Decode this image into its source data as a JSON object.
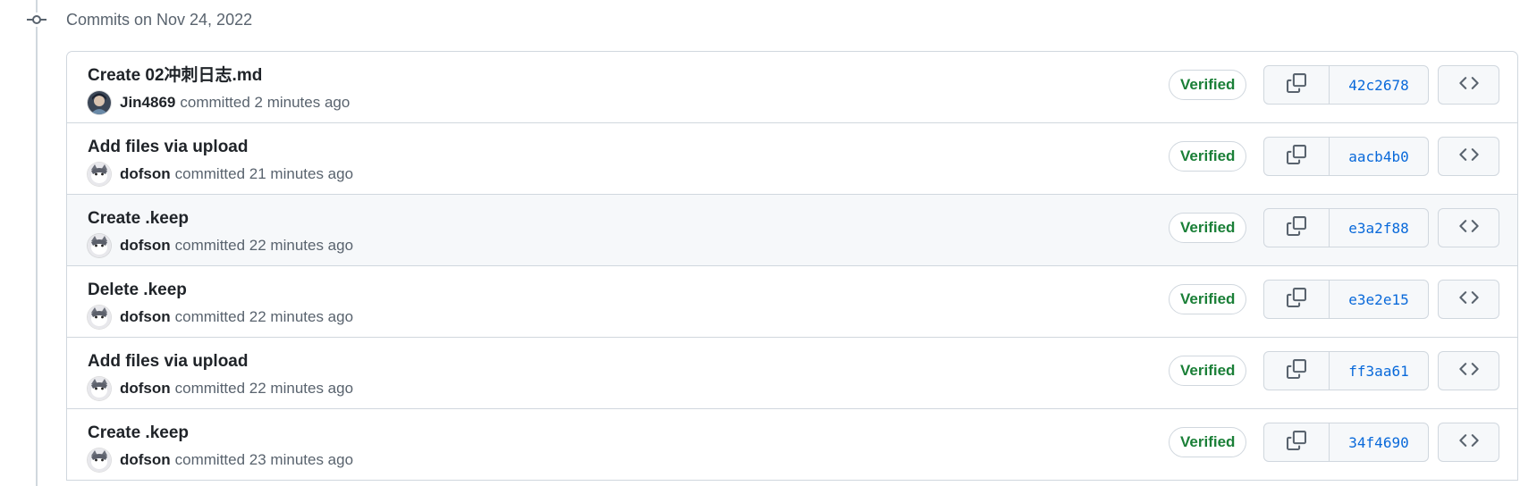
{
  "group": {
    "title": "Commits on Nov 24, 2022"
  },
  "commits": [
    {
      "title": "Create 02冲刺日志.md",
      "author": "Jin4869",
      "time_text": "committed 2 minutes ago",
      "badge": "Verified",
      "sha": "42c2678",
      "avatar_icon": "avatar-jin4869"
    },
    {
      "title": "Add files via upload",
      "author": "dofson",
      "time_text": "committed 21 minutes ago",
      "badge": "Verified",
      "sha": "aacb4b0",
      "avatar_icon": "avatar-dofson"
    },
    {
      "title": "Create .keep",
      "author": "dofson",
      "time_text": "committed 22 minutes ago",
      "badge": "Verified",
      "sha": "e3a2f88",
      "avatar_icon": "avatar-dofson"
    },
    {
      "title": "Delete .keep",
      "author": "dofson",
      "time_text": "committed 22 minutes ago",
      "badge": "Verified",
      "sha": "e3e2e15",
      "avatar_icon": "avatar-dofson"
    },
    {
      "title": "Add files via upload",
      "author": "dofson",
      "time_text": "committed 22 minutes ago",
      "badge": "Verified",
      "sha": "ff3aa61",
      "avatar_icon": "avatar-dofson"
    },
    {
      "title": "Create .keep",
      "author": "dofson",
      "time_text": "committed 23 minutes ago",
      "badge": "Verified",
      "sha": "34f4690",
      "avatar_icon": "avatar-dofson"
    }
  ],
  "icons": {
    "timeline": "git-commit-icon",
    "copy": "copy-icon",
    "browse": "code-icon"
  },
  "colors": {
    "verified": "#1a7f37",
    "sha_link": "#0969da",
    "border": "#d0d7de",
    "hover_row": "#f6f8fa"
  }
}
